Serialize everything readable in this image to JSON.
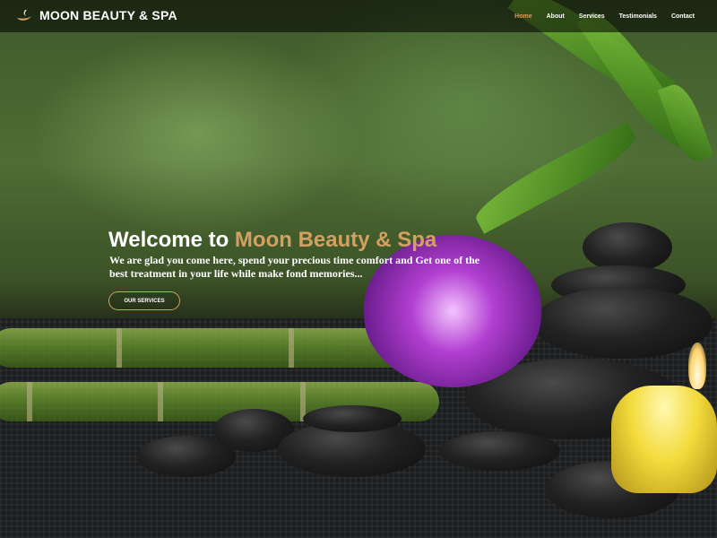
{
  "brand": {
    "name": "MOON BEAUTY & SPA"
  },
  "nav": {
    "items": [
      "Home",
      "About",
      "Services",
      "Testimonials",
      "Contact"
    ],
    "active": "Home"
  },
  "hero": {
    "title_prefix": "Welcome to",
    "title_accent": "Moon Beauty & Spa",
    "subtitle": "We are glad you come here, spend your precious time comfort and Get one of the best treatment in your life while make fond memories...",
    "button_label": "OUR SERVICES"
  },
  "colors": {
    "accent": "#d3a061",
    "text": "#ffffff"
  },
  "icons": {
    "logo": "moon-lamp-icon"
  }
}
